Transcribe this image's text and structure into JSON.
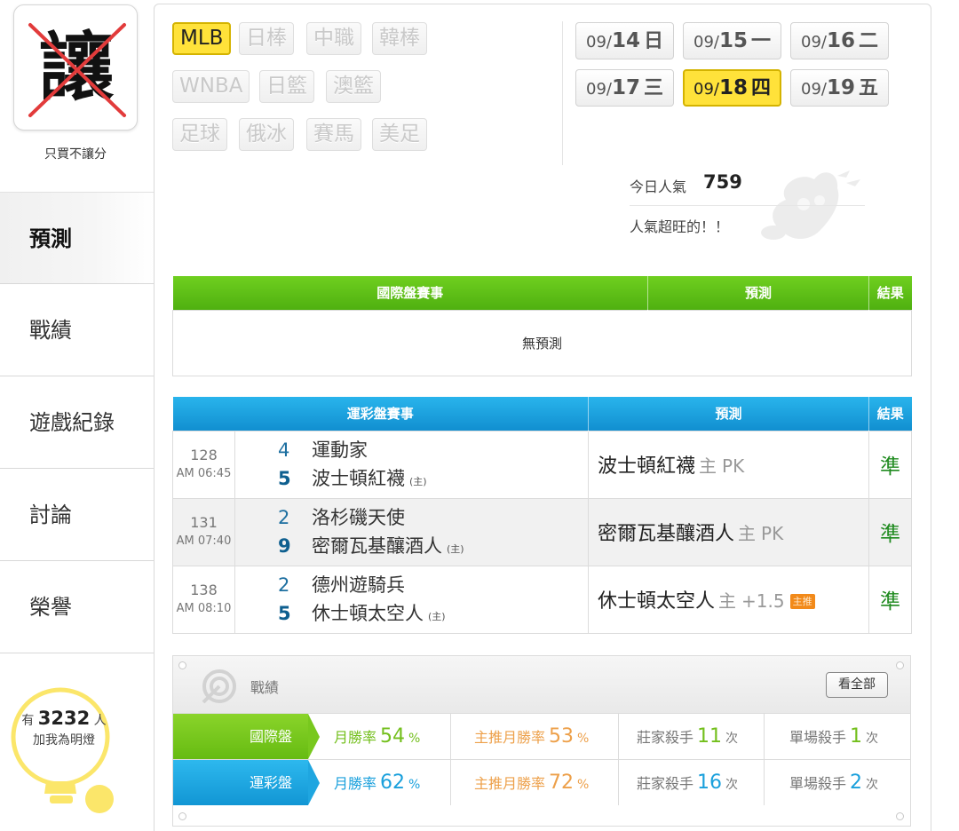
{
  "sidebar": {
    "logo_char": "讓",
    "logo_caption": "只買不讓分",
    "nav": [
      {
        "label": "預測",
        "active": true
      },
      {
        "label": "戰績",
        "active": false
      },
      {
        "label": "遊戲紀錄",
        "active": false
      },
      {
        "label": "討論",
        "active": false
      },
      {
        "label": "榮譽",
        "active": false
      }
    ],
    "fans": {
      "prefix": "有",
      "count": "3232",
      "unit": "人",
      "caption": "加我為明燈"
    }
  },
  "sports": [
    {
      "label": "MLB",
      "active": true
    },
    {
      "label": "日棒"
    },
    {
      "label": "中職"
    },
    {
      "label": "韓棒"
    },
    {
      "label": "WNBA"
    },
    {
      "label": "日籃"
    },
    {
      "label": "澳籃"
    },
    {
      "label": "足球"
    },
    {
      "label": "俄冰"
    },
    {
      "label": "賽馬"
    },
    {
      "label": "美足"
    }
  ],
  "dates": [
    {
      "month": "09/",
      "day": "14",
      "weekday": "日"
    },
    {
      "month": "09/",
      "day": "15",
      "weekday": "一"
    },
    {
      "month": "09/",
      "day": "16",
      "weekday": "二"
    },
    {
      "month": "09/",
      "day": "17",
      "weekday": "三"
    },
    {
      "month": "09/",
      "day": "18",
      "weekday": "四",
      "active": true
    },
    {
      "month": "09/",
      "day": "19",
      "weekday": "五"
    }
  ],
  "popularity": {
    "label": "今日人氣",
    "value": "759",
    "note": "人氣超旺的！！"
  },
  "intl_table": {
    "headers": [
      "國際盤賽事",
      "預測",
      "結果"
    ],
    "empty_text": "無預測"
  },
  "sport_table": {
    "headers": [
      "運彩盤賽事",
      "預測",
      "結果"
    ],
    "rows": [
      {
        "id": "128",
        "time": "AM 06:45",
        "away": {
          "score": "4",
          "name": "運動家"
        },
        "home": {
          "score": "5",
          "name": "波士頓紅襪",
          "tag": "(主)"
        },
        "pick": {
          "team": "波士頓紅襪",
          "side": "主",
          "line": "PK",
          "badge": ""
        },
        "result": "準"
      },
      {
        "id": "131",
        "time": "AM 07:40",
        "away": {
          "score": "2",
          "name": "洛杉磯天使"
        },
        "home": {
          "score": "9",
          "name": "密爾瓦基釀酒人",
          "tag": "(主)"
        },
        "pick": {
          "team": "密爾瓦基釀酒人",
          "side": "主",
          "line": "PK",
          "badge": ""
        },
        "result": "準"
      },
      {
        "id": "138",
        "time": "AM 08:10",
        "away": {
          "score": "2",
          "name": "德州遊騎兵"
        },
        "home": {
          "score": "5",
          "name": "休士頓太空人",
          "tag": "(主)"
        },
        "pick": {
          "team": "休士頓太空人",
          "side": "主",
          "line": "+1.5",
          "badge": "主推"
        },
        "result": "準"
      }
    ]
  },
  "record": {
    "title": "戰績",
    "view_all": "看全部",
    "rows": [
      {
        "label": "國際盤",
        "month_rate": {
          "label": "月勝率",
          "value": "54",
          "unit": "%"
        },
        "main_rate": {
          "label": "主推月勝率",
          "value": "53",
          "unit": "%"
        },
        "banker_killer": {
          "label": "莊家殺手",
          "value": "11",
          "unit": "次"
        },
        "single_killer": {
          "label": "單場殺手",
          "value": "1",
          "unit": "次"
        }
      },
      {
        "label": "運彩盤",
        "month_rate": {
          "label": "月勝率",
          "value": "62",
          "unit": "%"
        },
        "main_rate": {
          "label": "主推月勝率",
          "value": "72",
          "unit": "%"
        },
        "banker_killer": {
          "label": "莊家殺手",
          "value": "16",
          "unit": "次"
        },
        "single_killer": {
          "label": "單場殺手",
          "value": "2",
          "unit": "次"
        }
      }
    ]
  },
  "colors": {
    "accent_yellow": "#ffe23a",
    "table_green": "#5cbf14",
    "table_blue": "#1aa3e0",
    "result_green": "#1e8a1e",
    "badge_orange": "#f28a1a"
  }
}
